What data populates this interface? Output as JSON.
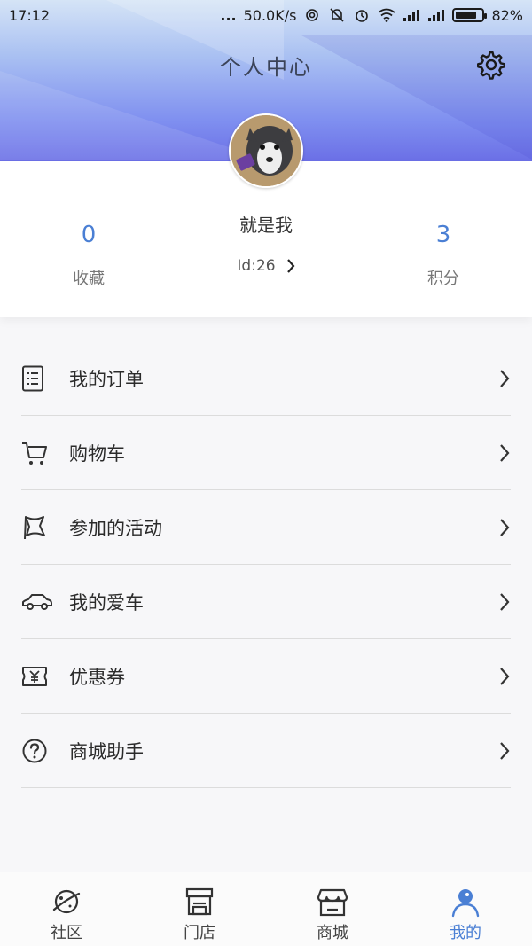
{
  "status_bar": {
    "time": "17:12",
    "dots": "...",
    "speed": "50.0K/s",
    "battery": "82%",
    "battery_level": 0.82
  },
  "header": {
    "title": "个人中心",
    "settings_icon": "gear-icon"
  },
  "profile": {
    "nickname": "就是我",
    "id_text": "Id:26",
    "favorites": {
      "value": "0",
      "label": "收藏"
    },
    "points": {
      "value": "3",
      "label": "积分"
    }
  },
  "menu": [
    {
      "label": "我的订单",
      "icon": "order-list-icon"
    },
    {
      "label": "购物车",
      "icon": "cart-icon"
    },
    {
      "label": "参加的活动",
      "icon": "flag-icon"
    },
    {
      "label": "我的爱车",
      "icon": "car-icon"
    },
    {
      "label": "优惠券",
      "icon": "coupon-icon"
    },
    {
      "label": "商城助手",
      "icon": "help-icon"
    }
  ],
  "bottom_nav": [
    {
      "label": "社区",
      "icon": "planet-icon",
      "active": false
    },
    {
      "label": "门店",
      "icon": "store-icon",
      "active": false
    },
    {
      "label": "商城",
      "icon": "shop-icon",
      "active": false
    },
    {
      "label": "我的",
      "icon": "user-icon",
      "active": true
    }
  ],
  "colors": {
    "accent": "#4a7fd4",
    "header_gradient_top": "#d5e4f6",
    "header_gradient_bottom": "#6b6fe6"
  }
}
